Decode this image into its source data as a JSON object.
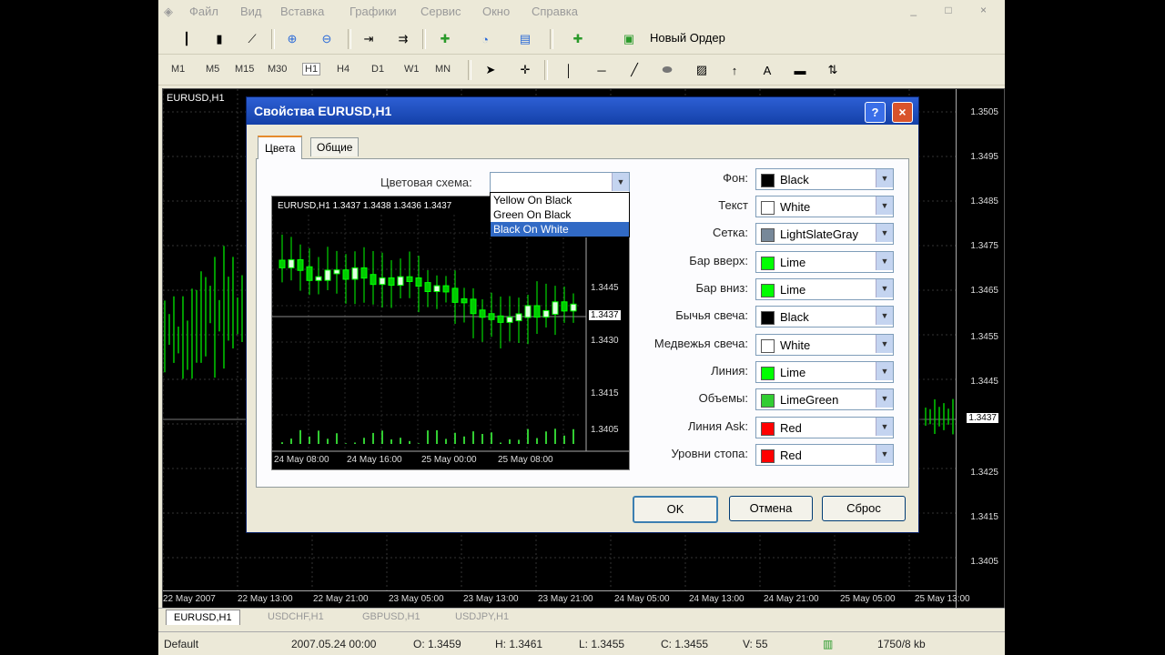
{
  "menu": [
    "Файл",
    "Вид",
    "Вставка",
    "Графики",
    "Сервис",
    "Окно",
    "Справка"
  ],
  "toolbar": {
    "new_order": "Новый Ордер",
    "timeframes": [
      "M1",
      "M5",
      "M15",
      "M30",
      "H1",
      "H4",
      "D1",
      "W1",
      "MN"
    ],
    "selected_timeframe": "H1"
  },
  "chart": {
    "label": "EURUSD,H1",
    "price_labels": [
      "1.3505",
      "1.3495",
      "1.3485",
      "1.3475",
      "1.3465",
      "1.3455",
      "1.3445",
      "1.3437",
      "1.3425",
      "1.3415",
      "1.3405"
    ],
    "current_price": "1.3437",
    "time_labels": [
      "22 May 2007",
      "22 May 13:00",
      "22 May 21:00",
      "23 May 05:00",
      "23 May 13:00",
      "23 May 21:00",
      "24 May 05:00",
      "24 May 13:00",
      "24 May 21:00",
      "25 May 05:00",
      "25 May 13:00"
    ]
  },
  "tabs": [
    "EURUSD,H1",
    "USDCHF,H1",
    "GBPUSD,H1",
    "USDJPY,H1"
  ],
  "status": {
    "profile": "Default",
    "datetime": "2007.05.24 00:00",
    "open": "O: 1.3459",
    "high": "H: 1.3461",
    "low": "L: 1.3455",
    "close": "C: 1.3455",
    "volume": "V: 55",
    "traffic": "1750/8 kb"
  },
  "dialog": {
    "title": "Свойства EURUSD,H1",
    "help": "?",
    "close": "×",
    "tab_colors": "Цвета",
    "tab_common": "Общие",
    "scheme_label": "Цветовая схема:",
    "scheme_options": [
      "Yellow On Black",
      "Green On Black",
      "Black On White"
    ],
    "preview": {
      "label": "EURUSD,H1  1.3437  1.3438  1.3436  1.3437",
      "price_labels": [
        "1.3445",
        "1.3437",
        "1.3430",
        "1.3415",
        "1.3405"
      ],
      "time_labels": [
        "24 May 08:00",
        "24 May 16:00",
        "25 May 00:00",
        "25 May 08:00"
      ]
    },
    "rows": [
      {
        "label": "Фон:",
        "value": "Black",
        "color": "#000000"
      },
      {
        "label": "Текст",
        "value": "White",
        "color": "#FFFFFF"
      },
      {
        "label": "Сетка:",
        "value": "LightSlateGray",
        "color": "#778899"
      },
      {
        "label": "Бар вверх:",
        "value": "Lime",
        "color": "#00FF00"
      },
      {
        "label": "Бар вниз:",
        "value": "Lime",
        "color": "#00FF00"
      },
      {
        "label": "Бычья свеча:",
        "value": "Black",
        "color": "#000000"
      },
      {
        "label": "Медвежья свеча:",
        "value": "White",
        "color": "#FFFFFF"
      },
      {
        "label": "Линия:",
        "value": "Lime",
        "color": "#00FF00"
      },
      {
        "label": "Объемы:",
        "value": "LimeGreen",
        "color": "#32CD32"
      },
      {
        "label": "Линия Ask:",
        "value": "Red",
        "color": "#FF0000"
      },
      {
        "label": "Уровни стопа:",
        "value": "Red",
        "color": "#FF0000"
      }
    ],
    "ok": "OK",
    "cancel": "Отмена",
    "reset": "Сброс"
  }
}
